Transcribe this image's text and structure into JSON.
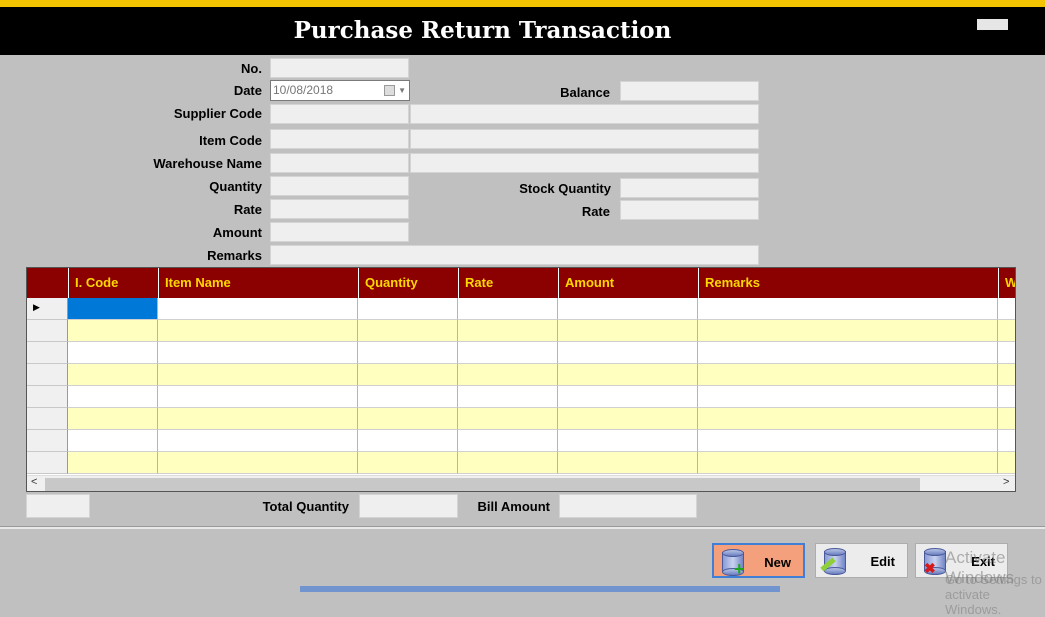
{
  "window": {
    "title": "Purchase Return Transaction"
  },
  "form": {
    "no_label": "No.",
    "no_value": "",
    "date_label": "Date",
    "date_value": "10/08/2018",
    "balance_label": "Balance",
    "balance_value": "",
    "supplier_code_label": "Supplier Code",
    "supplier_code_value": "",
    "supplier_name_value": "",
    "item_code_label": "Item Code",
    "item_code_value": "",
    "item_name_value": "",
    "warehouse_name_label": "Warehouse Name",
    "warehouse_code_value": "",
    "warehouse_name_value": "",
    "quantity_label": "Quantity",
    "quantity_value": "",
    "stock_quantity_label": "Stock Quantity",
    "stock_quantity_value": "",
    "rate_label": "Rate",
    "rate_value": "",
    "stock_rate_label": "Rate",
    "stock_rate_value": "",
    "amount_label": "Amount",
    "amount_value": "",
    "remarks_label": "Remarks",
    "remarks_value": ""
  },
  "grid": {
    "columns": [
      "I. Code",
      "Item Name",
      "Quantity",
      "Rate",
      "Amount",
      "Remarks",
      "W"
    ],
    "row_count": 8,
    "row_colors": [
      "#ffffff",
      "#ffffc0"
    ],
    "selected_cell_color": "#0078d7",
    "header_color": "#8b0000",
    "header_text_color": "#ffd700"
  },
  "totals": {
    "total_quantity_label": "Total Quantity",
    "total_quantity_value": "",
    "bill_amount_label": "Bill Amount",
    "bill_amount_value": ""
  },
  "buttons": {
    "new_label": "New",
    "edit_label": "Edit",
    "exit_label": "Exit"
  },
  "overlay": {
    "watermark_line1": "Activate Windows",
    "watermark_line2": "Go to Settings to activate Windows."
  },
  "icons": [
    "calendar-icon",
    "dropdown-arrow-icon",
    "row-pointer-icon",
    "scroll-left-icon",
    "scroll-right-icon",
    "database-add-icon",
    "database-edit-icon",
    "database-delete-icon"
  ]
}
